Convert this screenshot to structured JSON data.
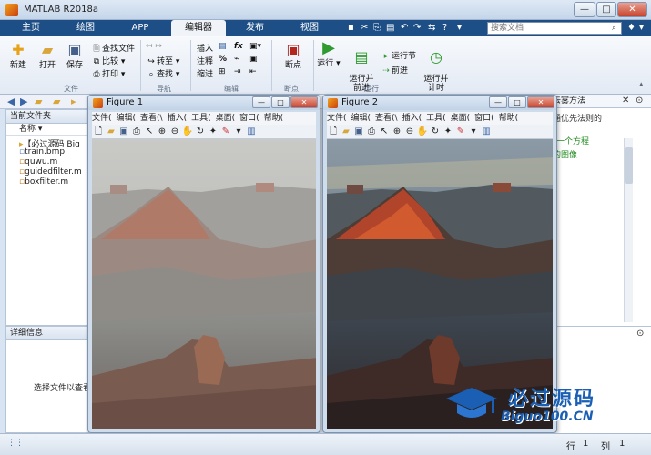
{
  "window": {
    "title": "MATLAB R2018a",
    "min": "—",
    "max": "□",
    "close": "✕"
  },
  "tabs": [
    {
      "label": "主页"
    },
    {
      "label": "绘图"
    },
    {
      "label": "APP"
    },
    {
      "label": "编辑器"
    },
    {
      "label": "发布"
    },
    {
      "label": "视图"
    }
  ],
  "search": {
    "placeholder": "搜索文档"
  },
  "toolstrip": {
    "file": {
      "new": "新建",
      "open": "打开",
      "save": "保存",
      "find_files": "查找文件",
      "compare": "比较",
      "print": "打印",
      "group": "文件"
    },
    "nav": {
      "goto": "转至",
      "find": "查找",
      "group": "导航"
    },
    "edit": {
      "insert": "插入",
      "comment": "注释",
      "indent": "缩进",
      "fx": "fx",
      "group": "编辑"
    },
    "breakpoints": {
      "label": "断点",
      "group": "断点"
    },
    "run": {
      "run": "运行",
      "run_advance": "运行并\n前进",
      "run_section": "运行节",
      "advance": "前进",
      "run_time": "运行并\n计时",
      "group": "运行"
    }
  },
  "left_panel": {
    "header": "当前文件夹",
    "column": "名称 ▾",
    "files": [
      {
        "name": "【必过源码 Big",
        "icon": "folder-icon"
      },
      {
        "name": "train.bmp",
        "icon": "image-file-icon"
      },
      {
        "name": "quwu.m",
        "icon": "m-file-icon"
      },
      {
        "name": "guidedfilter.m",
        "icon": "m-file-icon"
      },
      {
        "name": "boxfilter.m",
        "icon": "m-file-icon"
      }
    ],
    "detail_header": "详细信息",
    "detail_text": "选择文件以查看"
  },
  "right_panel": {
    "title": "去雾方法",
    "line1": "通优先法则的",
    "line2": "一个方程",
    "line3": "的图像"
  },
  "figures": [
    {
      "title": "Figure 1",
      "menus": [
        "文件(",
        "编辑(",
        "查看(\\",
        "插入(",
        "工具(",
        "桌面(",
        "窗口(",
        "帮助("
      ]
    },
    {
      "title": "Figure 2",
      "menus": [
        "文件(",
        "编辑(",
        "查看(\\",
        "插入(",
        "工具(",
        "桌面(",
        "窗口(",
        "帮助("
      ]
    }
  ],
  "status": {
    "row_label": "行",
    "row": "1",
    "col_label": "列",
    "col": "1"
  },
  "watermark": {
    "text": "必过源码",
    "domain": "Biguo100.CN"
  }
}
